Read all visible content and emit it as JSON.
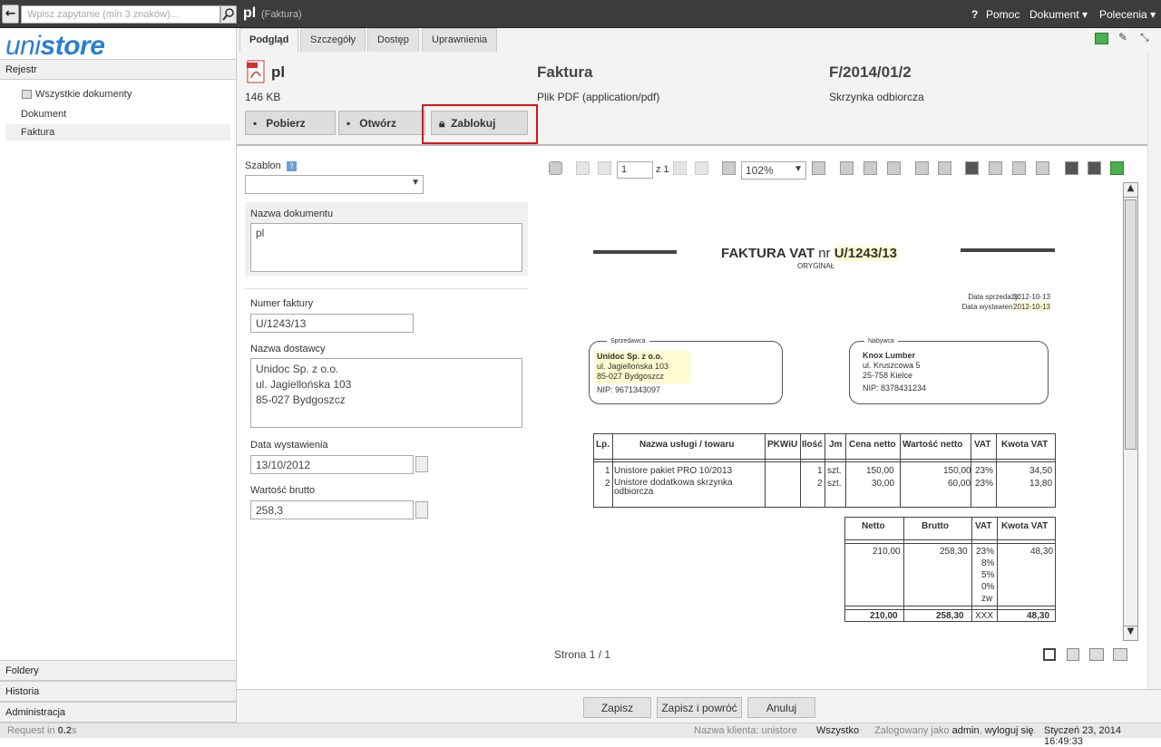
{
  "topbar": {
    "search_placeholder": "Wpisz zapytanie (min 3 znaków)...",
    "title": "pl",
    "doctype": "(Faktura)",
    "help": "Pomoc",
    "document_menu": "Dokument",
    "commands_menu": "Polecenia"
  },
  "sidebar": {
    "logo_prefix": "uni",
    "logo_suffix": "store",
    "register": "Rejestr",
    "items": [
      "Wszystkie dokumenty",
      "Dokument",
      "Faktura"
    ],
    "bottom": [
      "Foldery",
      "Historia",
      "Administracja"
    ]
  },
  "tabs": [
    "Podgląd",
    "Szczegóły",
    "Dostęp",
    "Uprawnienia"
  ],
  "header": {
    "name": "pl",
    "size": "146 KB",
    "type_title": "Faktura",
    "type_desc": "Plik PDF (application/pdf)",
    "number": "F/2014/01/2",
    "mailbox": "Skrzynka odbiorcza",
    "btn_download": "Pobierz",
    "btn_open": "Otwórz",
    "btn_lock": "Zablokuj"
  },
  "form": {
    "template_label": "Szablon",
    "docname_label": "Nazwa dokumentu",
    "docname_value": "pl",
    "invoice_no_label": "Numer faktury",
    "invoice_no_value": "U/1243/13",
    "supplier_label": "Nazwa dostawcy",
    "supplier_lines": [
      "Unidoc Sp. z o.o.",
      "ul. Jagiellońska 103",
      "85-027 Bydgoszcz"
    ],
    "date_label": "Data wystawienia",
    "date_value": "13/10/2012",
    "gross_label": "Wartość brutto",
    "gross_value": "258,3"
  },
  "viewer": {
    "page_input": "1",
    "page_of": "z 1",
    "zoom": "102%",
    "page_status": "Strona 1 / 1"
  },
  "invoice": {
    "title": "FAKTURA VAT",
    "nr": "nr",
    "number": "U/1243/13",
    "original": "ORYGINAŁ",
    "sale_date_label": "Data sprzedaży:",
    "sale_date": "2012-10-13",
    "issue_date_label": "Data wystawienia:",
    "issue_date": "2012-10-13",
    "seller_label": "Sprzedawca",
    "seller_name": "Unidoc Sp. z o.o.",
    "seller_street": "ul. Jagiellońska 103",
    "seller_city": "85-027 Bydgoszcz",
    "seller_nip": "NIP: 9671343097",
    "buyer_label": "Nabywca",
    "buyer_name": "Knox Lumber",
    "buyer_street": "ul. Kruszcowa 5",
    "buyer_city": "25-758 Kielce",
    "buyer_nip": "NIP: 8378431234",
    "items_header": [
      "Lp.",
      "Nazwa usługi / towaru",
      "PKWiU",
      "Ilość",
      "Jm",
      "Cena netto",
      "Wartość netto",
      "VAT",
      "Kwota VAT"
    ],
    "items": [
      [
        "1",
        "Unistore pakiet PRO 10/2013",
        "",
        "1",
        "szt.",
        "150,00",
        "150,00",
        "23%",
        "34,50"
      ],
      [
        "2",
        "Unistore dodatkowa skrzynka odbiorcza",
        "",
        "2",
        "szt.",
        "30,00",
        "60,00",
        "23%",
        "13,80"
      ]
    ],
    "sum_header": [
      "Netto",
      "Brutto",
      "VAT",
      "Kwota VAT"
    ],
    "sum_netto": "210,00",
    "sum_brutto": "258,30",
    "vat_rates": [
      "23%",
      "8%",
      "5%",
      "0%",
      "zw"
    ],
    "sum_kwota": "48,30",
    "total": [
      "210,00",
      "258,30",
      "XXX",
      "48,30"
    ]
  },
  "buttons": {
    "save": "Zapisz",
    "save_return": "Zapisz i powróć",
    "cancel": "Anuluj"
  },
  "status": {
    "request_prefix": "Request in",
    "request_time": "0.2",
    "request_unit": "s",
    "client_label": "Nazwa klienta: unistore",
    "system": "Wszystko",
    "logged_as": "Zalogowany jako",
    "user": "admin",
    "logout": "wyloguj się",
    "datetime": "Styczeń 23, 2014 16:49:33"
  },
  "colors": {
    "logo_blue": "#2a7fd4",
    "highlight_red": "#e01010",
    "topbar": "#3c3c3c"
  }
}
